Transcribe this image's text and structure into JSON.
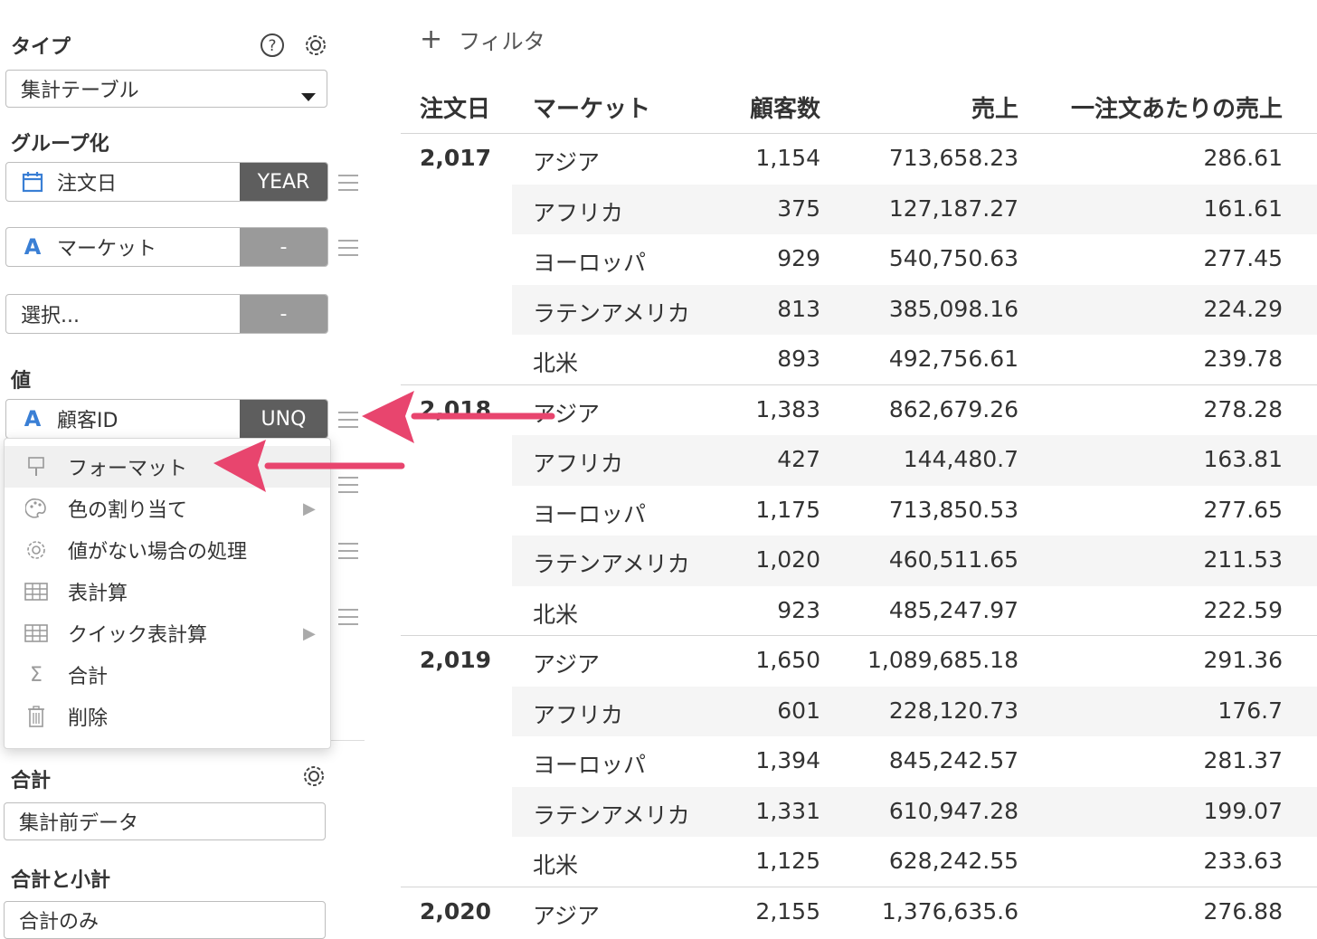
{
  "sidebar": {
    "type_label": "タイプ",
    "type_value": "集計テーブル",
    "group_label": "グループ化",
    "groups": [
      {
        "name": "注文日",
        "tag": "YEAR"
      },
      {
        "name": "マーケット",
        "tag": "-"
      },
      {
        "name": "選択...",
        "tag": "-"
      }
    ],
    "value_label": "値",
    "value_field": {
      "name": "顧客ID",
      "tag": "UNQ"
    },
    "total_label": "合計",
    "total_value": "集計前データ",
    "subtotal_label": "合計と小計",
    "subtotal_value": "合計のみ"
  },
  "menu": {
    "items": [
      {
        "label": "フォーマット",
        "icon": "paint-roller-icon"
      },
      {
        "label": "色の割り当て",
        "icon": "palette-icon"
      },
      {
        "label": "値がない場合の処理",
        "icon": "gear-icon"
      },
      {
        "label": "表計算",
        "icon": "table-icon"
      },
      {
        "label": "クイック表計算",
        "icon": "table-icon"
      },
      {
        "label": "合計",
        "icon": "sigma-icon"
      },
      {
        "label": "削除",
        "icon": "trash-icon"
      }
    ]
  },
  "filter_label": "フィルタ",
  "table": {
    "headers": [
      "注文日",
      "マーケット",
      "顧客数",
      "売上",
      "一注文あたりの売上"
    ],
    "groups": [
      {
        "year": "2,017",
        "rows": [
          [
            "アジア",
            "1,154",
            "713,658.23",
            "286.61"
          ],
          [
            "アフリカ",
            "375",
            "127,187.27",
            "161.61"
          ],
          [
            "ヨーロッパ",
            "929",
            "540,750.63",
            "277.45"
          ],
          [
            "ラテンアメリカ",
            "813",
            "385,098.16",
            "224.29"
          ],
          [
            "北米",
            "893",
            "492,756.61",
            "239.78"
          ]
        ]
      },
      {
        "year": "2,018",
        "rows": [
          [
            "アジア",
            "1,383",
            "862,679.26",
            "278.28"
          ],
          [
            "アフリカ",
            "427",
            "144,480.7",
            "163.81"
          ],
          [
            "ヨーロッパ",
            "1,175",
            "713,850.53",
            "277.65"
          ],
          [
            "ラテンアメリカ",
            "1,020",
            "460,511.65",
            "211.53"
          ],
          [
            "北米",
            "923",
            "485,247.97",
            "222.59"
          ]
        ]
      },
      {
        "year": "2,019",
        "rows": [
          [
            "アジア",
            "1,650",
            "1,089,685.18",
            "291.36"
          ],
          [
            "アフリカ",
            "601",
            "228,120.73",
            "176.7"
          ],
          [
            "ヨーロッパ",
            "1,394",
            "845,242.57",
            "281.37"
          ],
          [
            "ラテンアメリカ",
            "1,331",
            "610,947.28",
            "199.07"
          ],
          [
            "北米",
            "1,125",
            "628,242.55",
            "233.63"
          ]
        ]
      },
      {
        "year": "2,020",
        "rows": [
          [
            "アジア",
            "2,155",
            "1,376,635.6",
            "276.88"
          ]
        ]
      }
    ]
  },
  "colors": {
    "accent_blue": "#3a7fd5",
    "arrow_pink": "#e8456e",
    "tag_dark": "#5e5e5e",
    "tag_mid": "#9a9a9a"
  }
}
